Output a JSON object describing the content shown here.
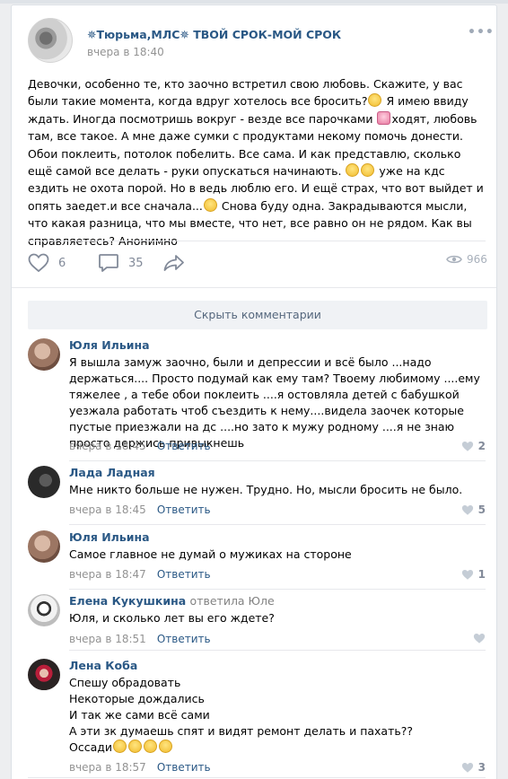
{
  "post": {
    "group_name": "✵Тюрьма,МЛС✵ ТВОЙ СРОК-МОЙ СРОК",
    "time": "вчера в 18:40",
    "text_parts": [
      "Девочки, особенно те, кто заочно встретил свою любовь. Скажите, у вас были такие момента, когда вдруг хотелось все бросить?",
      " Я имею ввиду ждать. Иногда посмотришь вокруг - везде все парочками ",
      "ходят, любовь там, все такое. А мне даже сумки с продуктами некому помочь донести. Обои поклеить, потолок побелить. Все сама. И как представлю, сколько ещё самой все делать - руки опускаться начинають.",
      " уже на кдс ездить не охота порой. Но в ведь люблю его. И ещё страх, что вот выйдет и опять заедет.и все сначала...",
      " Снова буду одна. Закрадываются мысли, что какая разница, что мы вместе, что нет, все равно он не рядом. Как вы справляетесь? Анонимно"
    ],
    "likes": "6",
    "comments": "35",
    "views": "966"
  },
  "hide_comments_label": "Скрыть комментарии",
  "comments": [
    {
      "author": "Юля Ильина",
      "reply_to": "",
      "text": "Я вышла замуж заочно, были и депрессии и всё было ...надо держаться.... Просто подумай как ему там? Твоему любимому ....ему тяжелее , а тебе обои поклеить ....я остовляла детей с бабушкой уезжала работать чтоб съездить к нему....видела заочек которые пустые приезжали на дс ....но зато к мужу родному ....я не знаю просто держись привыкнешь",
      "time": "вчера в 18:45",
      "reply_label": "Ответить",
      "likes": "2"
    },
    {
      "author": "Лада Ладная",
      "reply_to": "",
      "text": "Мне никто больше не нужен. Трудно. Но, мысли бросить не было.",
      "time": "вчера в 18:45",
      "reply_label": "Ответить",
      "likes": "5"
    },
    {
      "author": "Юля Ильина",
      "reply_to": "",
      "text": "Самое главное не думай о мужиках на стороне",
      "time": "вчера в 18:47",
      "reply_label": "Ответить",
      "likes": "1"
    },
    {
      "author": "Елена Кукушкина",
      "reply_to": "ответила Юле",
      "text": "Юля, и сколько лет вы его ждете?",
      "time": "вчера в 18:51",
      "reply_label": "Ответить",
      "likes": ""
    },
    {
      "author": "Лена Коба",
      "reply_to": "",
      "text_lines": [
        "Спешу обрадовать",
        "Некоторые дождались",
        "И так же сами всё сами",
        "А эти зк думаешь спят и видят ремонт делать и пахать??",
        "Оссади"
      ],
      "time": "вчера в 18:57",
      "reply_label": "Ответить",
      "likes": "3"
    }
  ],
  "colors": {
    "link": "#2a5885",
    "meta": "#939393",
    "icon": "#828a99"
  }
}
